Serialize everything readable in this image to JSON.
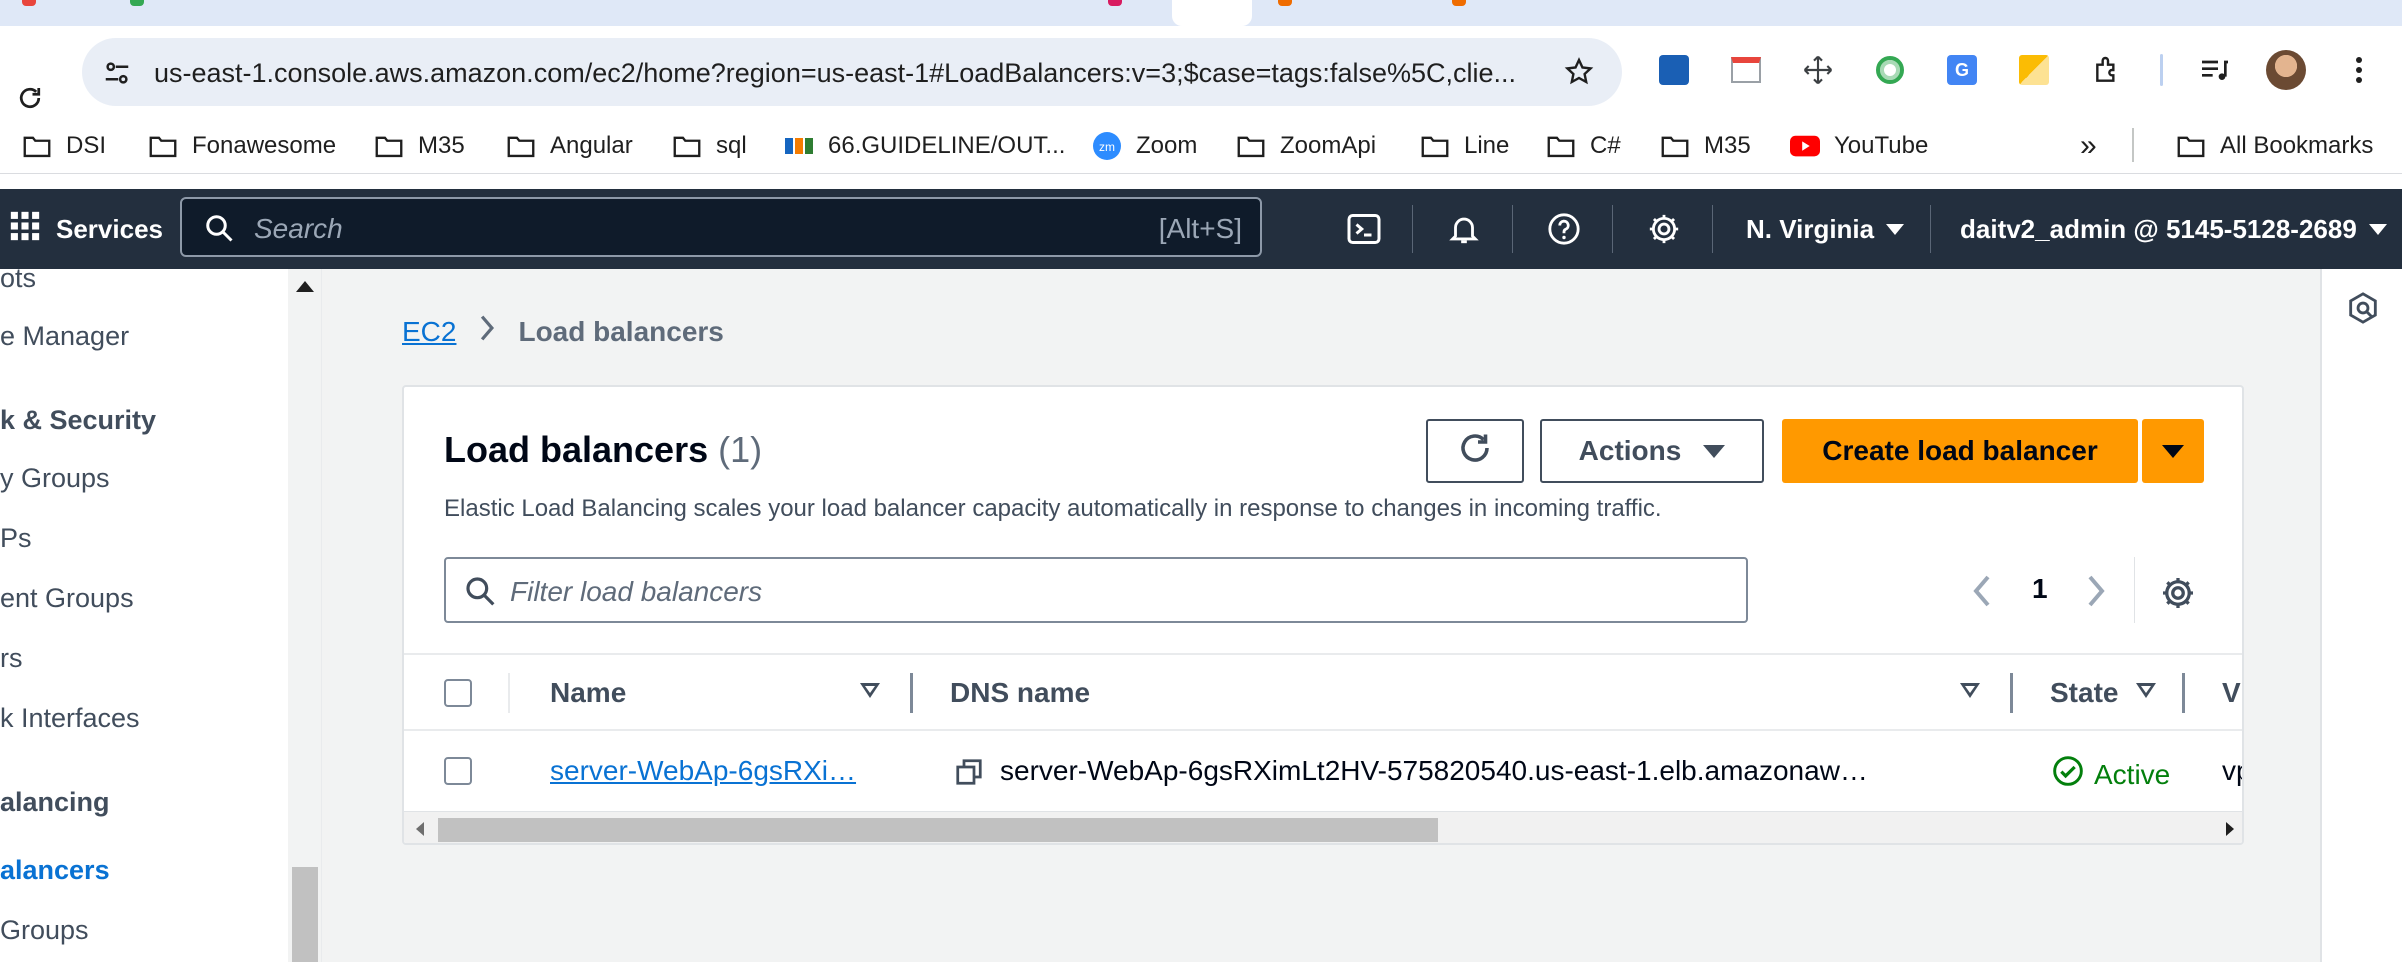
{
  "browser": {
    "url": "us-east-1.console.aws.amazon.com/ec2/home?region=us-east-1#LoadBalancers:v=3;$case=tags:false%5C,clie...",
    "bookmarks": [
      {
        "label": "DSI",
        "icon": "folder-icon"
      },
      {
        "label": "Fonawesome",
        "icon": "folder-icon"
      },
      {
        "label": "M35",
        "icon": "folder-icon"
      },
      {
        "label": "Angular",
        "icon": "folder-icon"
      },
      {
        "label": "sql",
        "icon": "folder-icon"
      },
      {
        "label": "66.GUIDELINE/OUT...",
        "icon": "fpt-icon"
      },
      {
        "label": "Zoom",
        "icon": "zoom-icon"
      },
      {
        "label": "ZoomApi",
        "icon": "folder-icon"
      },
      {
        "label": "Line",
        "icon": "folder-icon"
      },
      {
        "label": "C#",
        "icon": "folder-icon"
      },
      {
        "label": "M35",
        "icon": "folder-icon"
      },
      {
        "label": "YouTube",
        "icon": "youtube-icon"
      }
    ],
    "overflow_label": "»",
    "all_bookmarks": "All Bookmarks"
  },
  "aws_nav": {
    "services": "Services",
    "search_placeholder": "Search",
    "search_shortcut": "[Alt+S]",
    "region": "N. Virginia",
    "account": "daitv2_admin @ 5145-5128-2689"
  },
  "sidebar": {
    "items": [
      {
        "label": "ots",
        "kind": "item"
      },
      {
        "label": "e Manager",
        "kind": "item"
      },
      {
        "label": "k & Security",
        "kind": "heading"
      },
      {
        "label": "y Groups",
        "kind": "item"
      },
      {
        "label": "Ps",
        "kind": "item"
      },
      {
        "label": "ent Groups",
        "kind": "item"
      },
      {
        "label": "rs",
        "kind": "item"
      },
      {
        "label": "k Interfaces",
        "kind": "item"
      },
      {
        "label": "alancing",
        "kind": "heading"
      },
      {
        "label": "alancers",
        "kind": "active"
      },
      {
        "label": "Groups",
        "kind": "item"
      }
    ]
  },
  "breadcrumb": {
    "root": "EC2",
    "current": "Load balancers"
  },
  "panel": {
    "title": "Load balancers",
    "count": "(1)",
    "description": "Elastic Load Balancing scales your load balancer capacity automatically in response to changes in incoming traffic.",
    "actions_label": "Actions",
    "create_label": "Create load balancer",
    "filter_placeholder": "Filter load balancers",
    "page": "1"
  },
  "table": {
    "columns": [
      "Name",
      "DNS name",
      "State",
      "VI"
    ],
    "rows": [
      {
        "name": "server-WebAp-6gsRXi…",
        "dns": "server-WebAp-6gsRXimLt2HV-575820540.us-east-1.elb.amazonaw…",
        "state": "Active",
        "vpc": "vp"
      }
    ]
  },
  "colors": {
    "aws_nav_bg": "#232f3e",
    "primary_button": "#ff9900",
    "link": "#0972d3",
    "status_active": "#037f0c"
  }
}
